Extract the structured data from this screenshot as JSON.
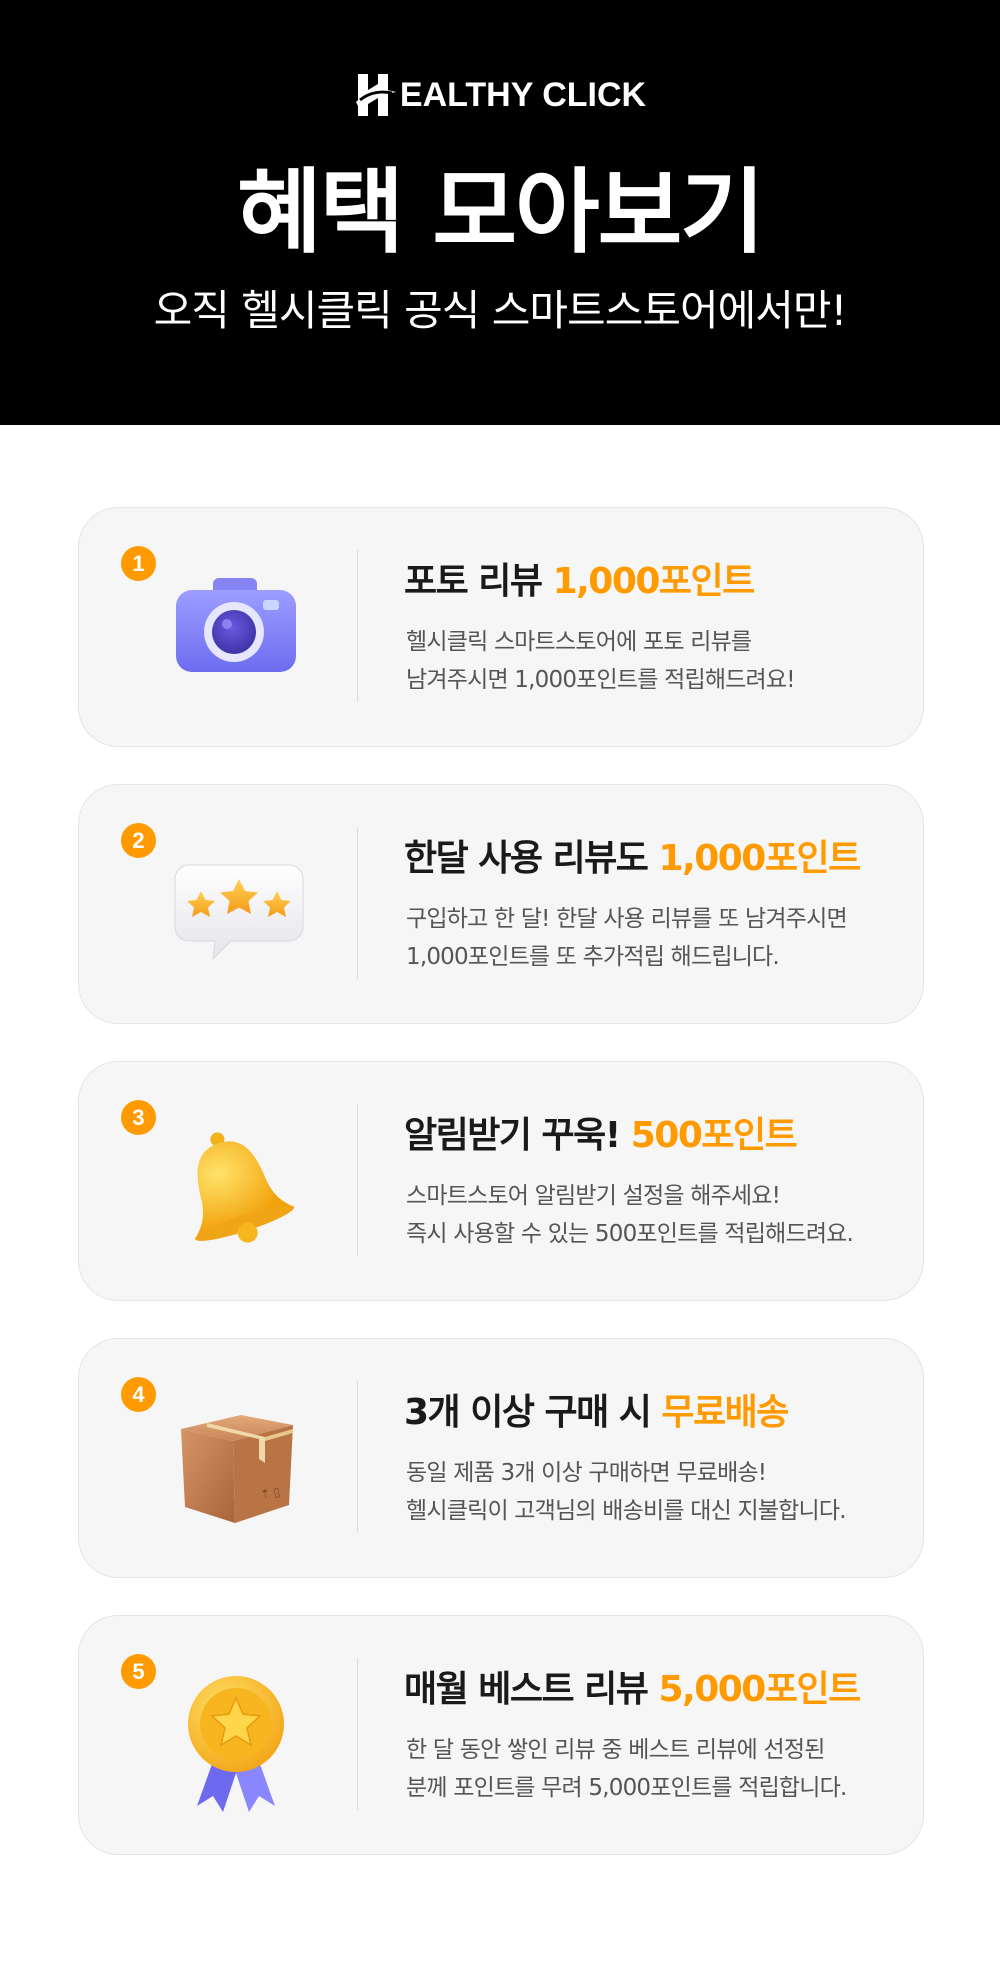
{
  "header": {
    "logo_text": "EALTHY CLICK",
    "title": "혜택 모아보기",
    "subtitle": "오직 헬시클릭 공식 스마트스토어에서만!"
  },
  "benefits": [
    {
      "number": "1",
      "icon": "camera-icon",
      "title": "포토 리뷰",
      "highlight": "1,000포인트",
      "desc_line1": "헬시클릭 스마트스토어에 포토 리뷰를",
      "desc_line2": "남겨주시면 1,000포인트를 적립해드려요!"
    },
    {
      "number": "2",
      "icon": "star-speech-bubble-icon",
      "title": "한달 사용 리뷰도",
      "highlight": "1,000포인트",
      "desc_line1": "구입하고 한 달! 한달 사용 리뷰를 또 남겨주시면",
      "desc_line2": "1,000포인트를 또 추가적립 해드립니다."
    },
    {
      "number": "3",
      "icon": "bell-icon",
      "title": "알림받기 꾸욱!",
      "highlight": "500포인트",
      "desc_line1": "스마트스토어 알림받기 설정을 해주세요!",
      "desc_line2": "즉시 사용할 수 있는 500포인트를 적립해드려요."
    },
    {
      "number": "4",
      "icon": "box-icon",
      "title": "3개 이상 구매 시",
      "highlight": "무료배송",
      "desc_line1": "동일 제품 3개 이상 구매하면 무료배송!",
      "desc_line2": "헬시클릭이 고객님의 배송비를 대신 지불합니다."
    },
    {
      "number": "5",
      "icon": "medal-icon",
      "title": "매월 베스트 리뷰",
      "highlight": "5,000포인트",
      "desc_line1": "한 달 동안 쌓인 리뷰 중 베스트 리뷰에 선정된",
      "desc_line2": "분께 포인트를 무려 5,000포인트를 적립합니다."
    }
  ],
  "colors": {
    "header_bg": "#000000",
    "accent": "#ff9a00",
    "card_bg": "#f6f6f6"
  }
}
